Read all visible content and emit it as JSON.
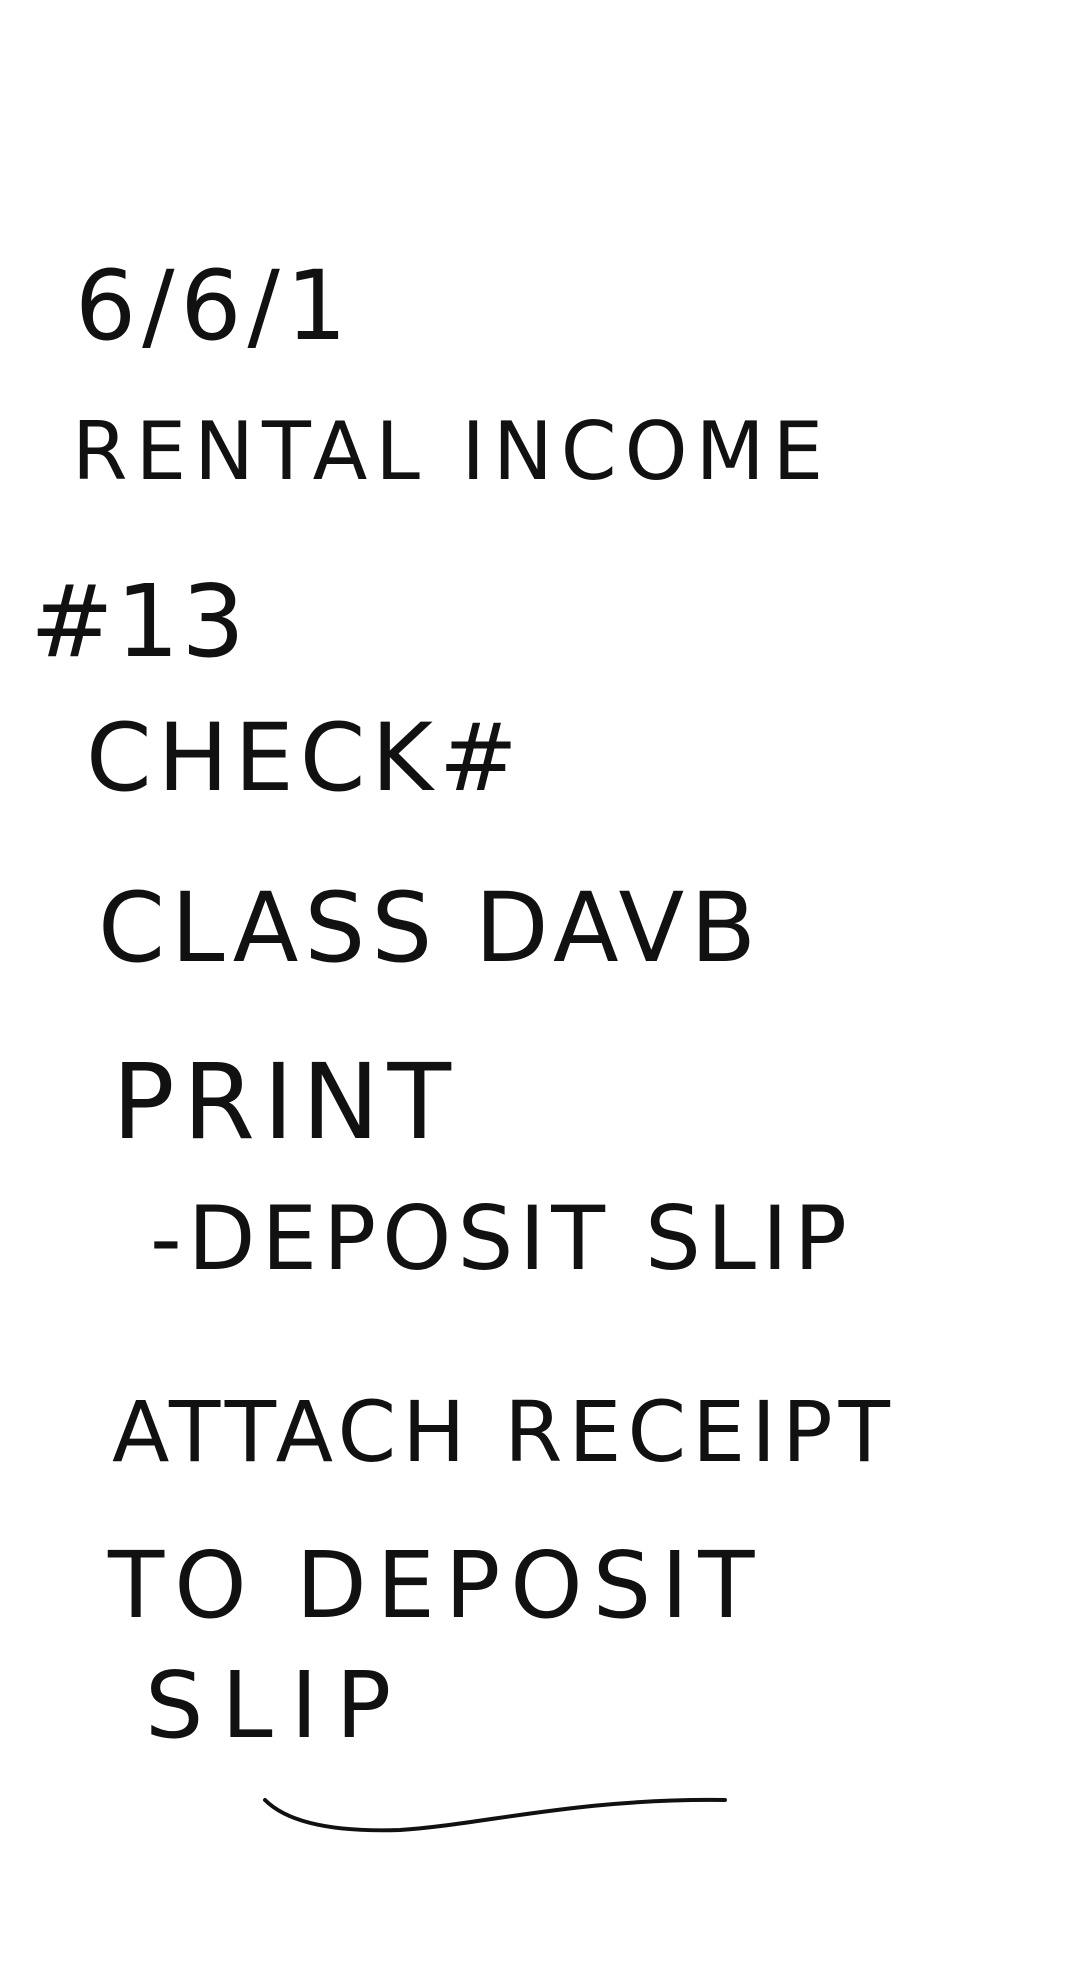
{
  "note": {
    "ink_color": "#111111",
    "background_color": "#ffffff",
    "lines": [
      "6/6/1",
      "RENTAL INCOME",
      "#13",
      "CHECK#",
      "CLASS DAVB",
      "PRINT",
      "-DEPOSIT SLIP",
      "ATTACH RECEIPT",
      "TO DEPOSIT",
      "SLIP"
    ]
  }
}
